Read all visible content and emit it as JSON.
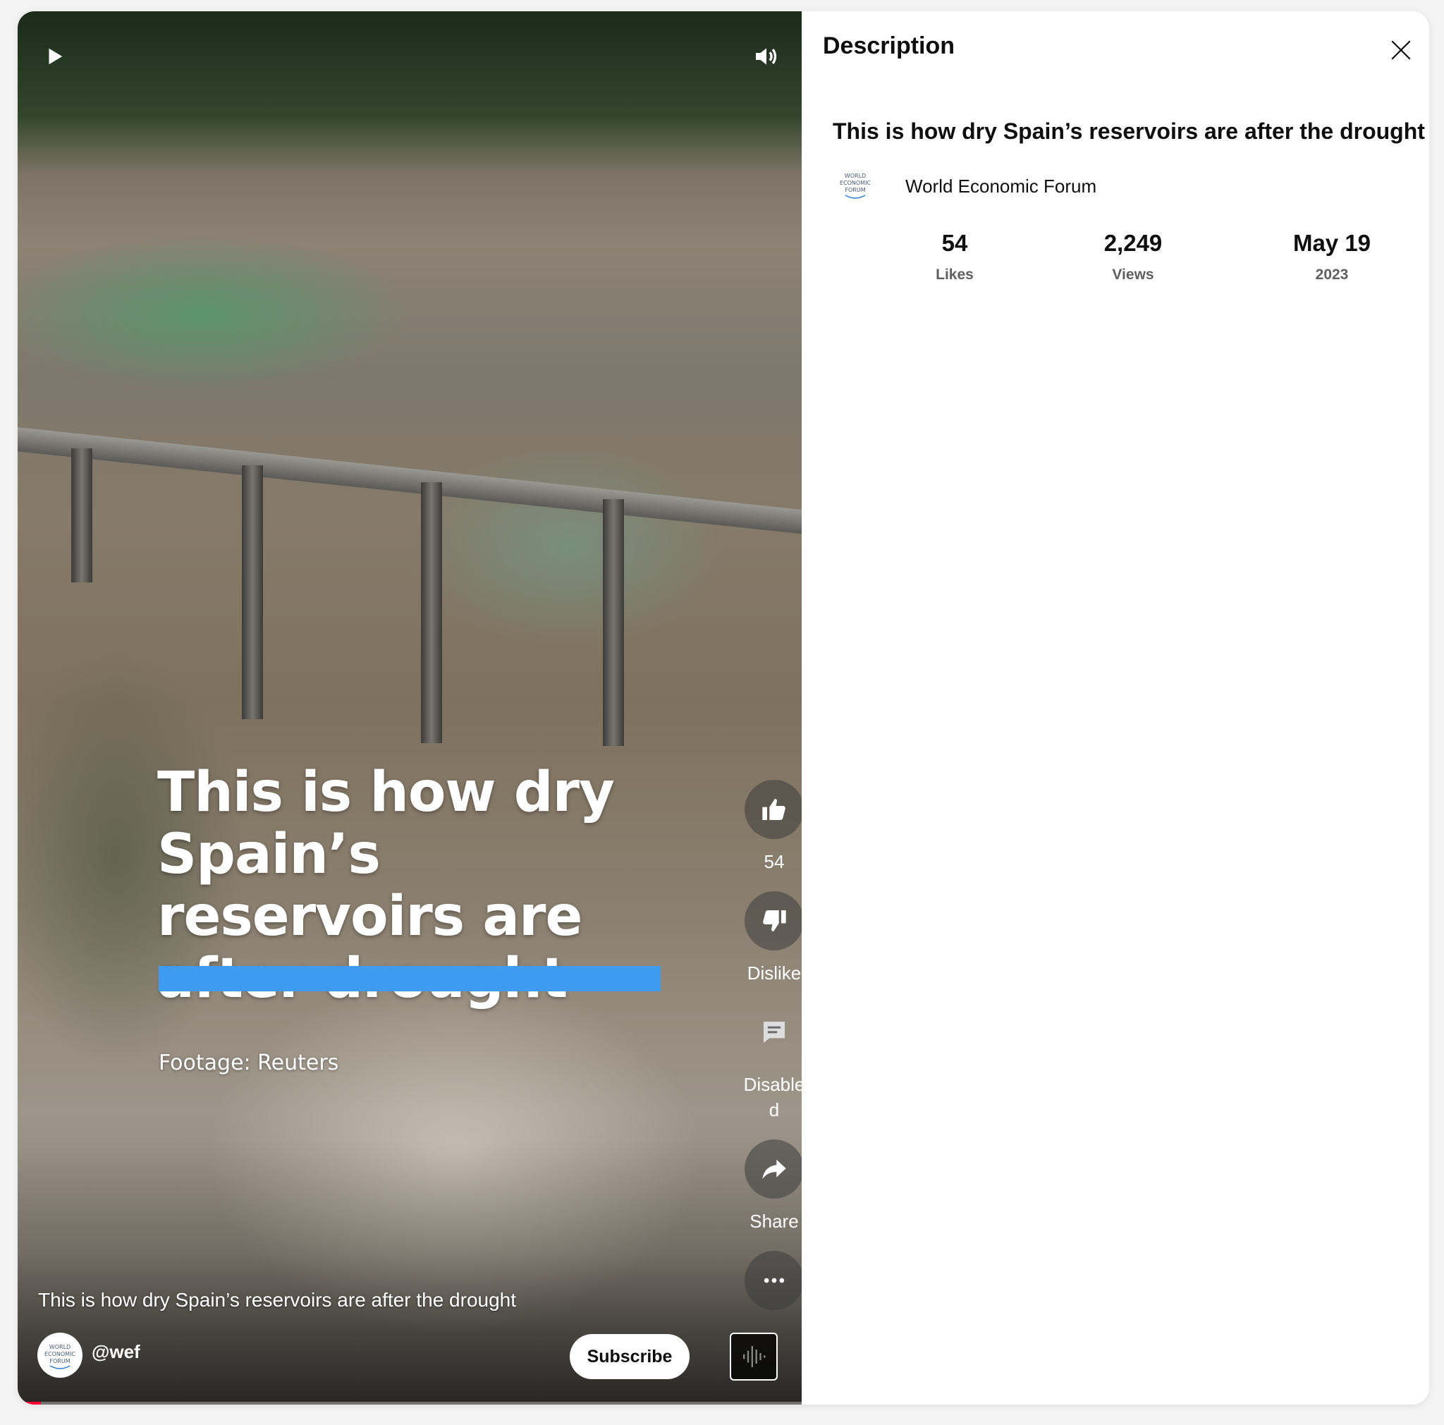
{
  "video": {
    "overlay_title": "This is how dry Spain’s reservoirs are after drought",
    "overlay_footage": "Footage: Reuters",
    "caption": "This is how dry Spain’s reservoirs are after the drought",
    "channel_handle": "@wef",
    "subscribe_label": "Subscribe",
    "avatar_text": [
      "WORLD",
      "ECONOMIC",
      "FORUM"
    ],
    "progress": 0.03,
    "actions": {
      "like_count": "54",
      "dislike_label": "Dislike",
      "comments_label": "Disable d",
      "share_label": "Share"
    },
    "colors": {
      "overlay_bar": "#3e9bf0",
      "progress": "#ff0033"
    }
  },
  "description": {
    "header": "Description",
    "title": "This is how dry Spain’s reservoirs are after the drought",
    "channel_name": "World Economic Forum",
    "stats": [
      {
        "value": "54",
        "label": "Likes"
      },
      {
        "value": "2,249",
        "label": "Views"
      },
      {
        "value": "May 19",
        "label": "2023"
      }
    ]
  },
  "icons": {
    "play": "play-icon",
    "volume": "volume-icon",
    "like": "thumbs-up-icon",
    "dislike": "thumbs-down-icon",
    "comments": "comment-icon",
    "share": "share-arrow-icon",
    "more": "more-dots-icon",
    "sound": "sound-wave-icon",
    "close": "close-icon"
  }
}
